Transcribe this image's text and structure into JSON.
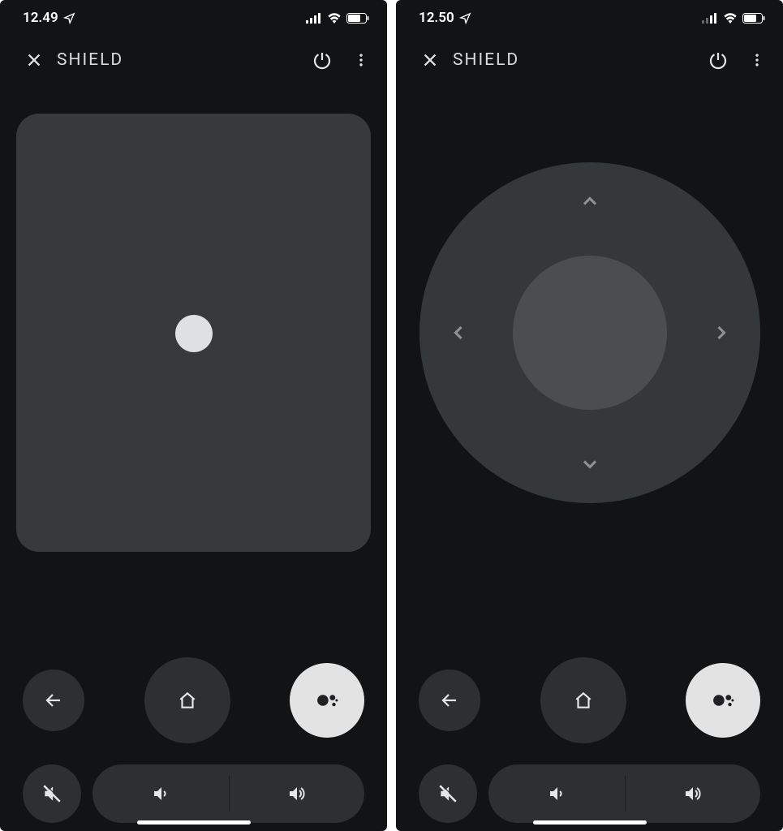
{
  "screens": [
    {
      "status": {
        "time": "12.49"
      },
      "header": {
        "title": "SHIELD"
      },
      "control_mode": "touchpad"
    },
    {
      "status": {
        "time": "12.50"
      },
      "header": {
        "title": "SHIELD"
      },
      "control_mode": "dpad"
    }
  ],
  "buttons": {
    "back": "Back",
    "home": "Home",
    "assistant": "Google Assistant",
    "mute": "Mute",
    "vol_down": "Volume down",
    "vol_up": "Volume up",
    "power": "Power",
    "more": "More options",
    "close": "Close"
  }
}
